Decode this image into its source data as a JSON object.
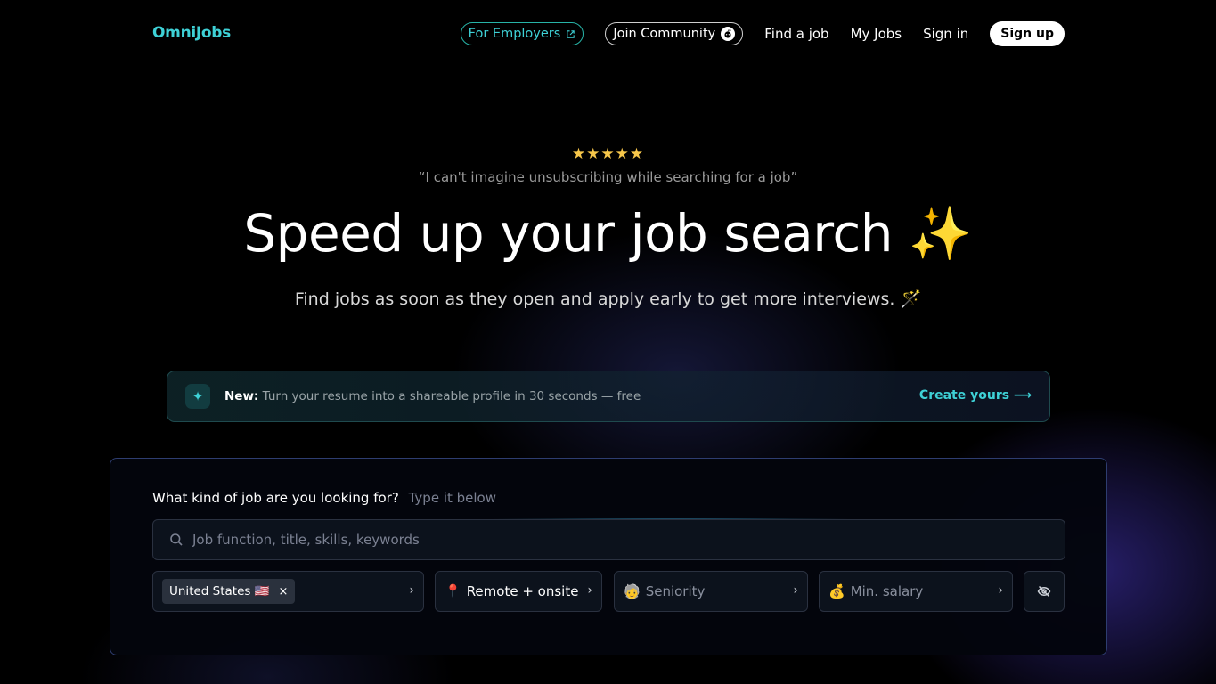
{
  "nav": {
    "logo": "OmniJobs",
    "for_employers": "For Employers",
    "join_community": "Join Community",
    "find_job": "Find a job",
    "my_jobs": "My Jobs",
    "sign_in": "Sign in",
    "sign_up": "Sign up"
  },
  "hero": {
    "stars": "★★★★★",
    "rating": 5,
    "quote": "“I can't imagine unsubscribing while searching for a job”",
    "headline": "Speed up your job search ✨",
    "subline": "Find jobs as soon as they open and apply early to get more interviews. 🪄"
  },
  "banner": {
    "badge": "New:",
    "text": "Turn your resume into a shareable profile in 30 seconds — free",
    "cta": "Create yours ⟶"
  },
  "search": {
    "question": "What kind of job are you looking for?",
    "hint": "Type it below",
    "placeholder": "Job function, title, skills, keywords",
    "value": ""
  },
  "filters": {
    "country_chip": "United States 🇺🇸",
    "chip_remove": "×",
    "remote_icon": "📍",
    "remote": "Remote + onsite",
    "seniority_icon": "🧓",
    "seniority": "Seniority",
    "salary_icon": "💰",
    "salary": "Min. salary",
    "chevron": "›"
  },
  "colors": {
    "accent": "#3ed1d6",
    "panel_border": "#2e3d70",
    "background": "#000000"
  }
}
